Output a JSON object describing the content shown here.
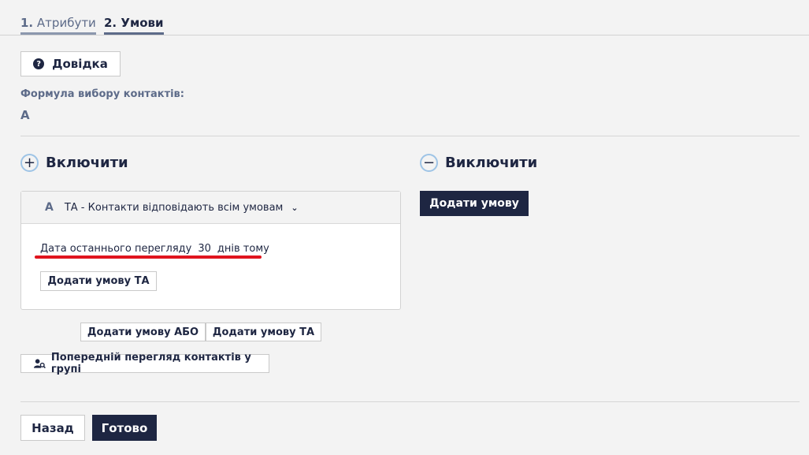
{
  "tabs": [
    {
      "num": "1.",
      "label": "Атрибути"
    },
    {
      "num": "2.",
      "label": "Умови"
    }
  ],
  "help_button": {
    "label": "Довідка",
    "icon": "question-circle-icon"
  },
  "formula": {
    "label": "Формула вибору контактів:",
    "value": "A"
  },
  "include": {
    "icon": "+",
    "title": "Включити"
  },
  "exclude": {
    "icon": "−",
    "title": "Виключити",
    "add_condition_label": "Додати умову"
  },
  "group": {
    "letter": "A",
    "title": "ТА - Контакти відповідають всім умовам",
    "chevron": "⌄",
    "condition": {
      "field": "Дата останнього перегляду",
      "value": "30",
      "unit": "днів тому"
    },
    "add_and_label": "Додати умову ТА"
  },
  "add_or_label": "Додати умову АБО",
  "add_and_label": "Додати умову ТА",
  "preview_label": "Попередній перегляд контактів у групі",
  "footer": {
    "back_label": "Назад",
    "done_label": "Готово"
  },
  "colors": {
    "primary_dark": "#1e2642",
    "accent_red": "#e0141e",
    "circle_blue": "#9ec4e6"
  }
}
